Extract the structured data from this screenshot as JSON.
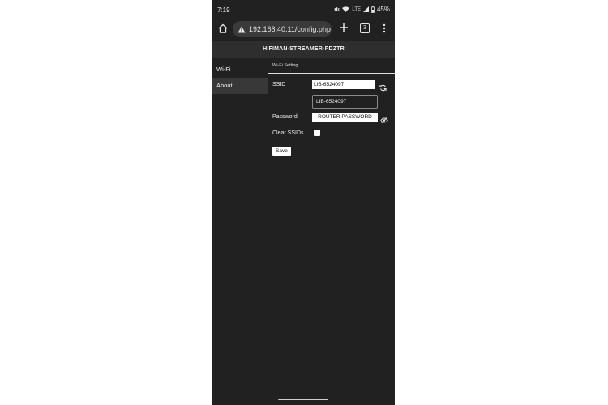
{
  "status_bar": {
    "time": "7:19",
    "network": "LTE",
    "battery": "45%"
  },
  "browser": {
    "url": "192.168.40.11/config.php",
    "tab_count": "3"
  },
  "page": {
    "header_title": "HIFIMAN-STREAMER-PDZTR",
    "sidebar": {
      "items": [
        {
          "label": "Wi-Fi",
          "active": false
        },
        {
          "label": "About",
          "active": true
        }
      ]
    },
    "section_title": "Wi-Fi Setting",
    "form": {
      "ssid_label": "SSID",
      "ssid_value": "LIB-6524097",
      "ssid_select_value": "LIB-6524097",
      "password_label": "Password",
      "password_placeholder": "ROUTER PASSWORD",
      "clear_ssids_label": "Clear SSIDs",
      "clear_ssids_checked": false,
      "save_label": "Save"
    }
  },
  "colors": {
    "background": "#212121",
    "header_bar": "#2e2e2e",
    "active_item": "#383838",
    "text": "#f0f0f0"
  }
}
